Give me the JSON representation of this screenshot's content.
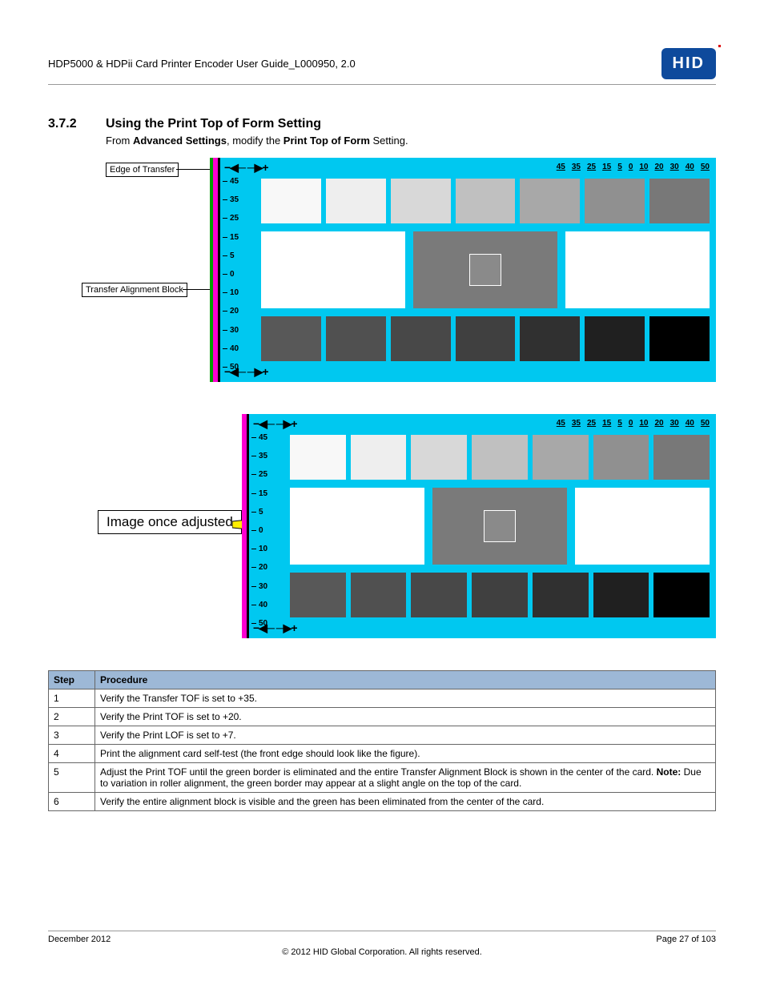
{
  "header": {
    "doc_title": "HDP5000 & HDPii Card Printer Encoder User Guide_L000950, 2.0",
    "logo_text": "HID"
  },
  "section": {
    "number": "3.7.2",
    "title": "Using the Print Top of Form Setting",
    "intro_pre": "From ",
    "intro_b1": "Advanced Settings",
    "intro_mid": ", modify the ",
    "intro_b2": "Print Top of Form",
    "intro_post": " Setting."
  },
  "figure1": {
    "callout_edge": "Edge of Transfer",
    "callout_block": "Transfer Alignment Block",
    "v_ticks": [
      "45",
      "35",
      "25",
      "15",
      "5",
      "0",
      "10",
      "20",
      "30",
      "40",
      "50"
    ],
    "h_numbers": [
      "45",
      "35",
      "25",
      "15",
      "5",
      "0",
      "10",
      "20",
      "30",
      "40",
      "50"
    ],
    "arrows": "−◀─ ─▶+"
  },
  "figure2": {
    "callout": "Image once adjusted",
    "v_ticks": [
      "45",
      "35",
      "25",
      "15",
      "5",
      "0",
      "10",
      "20",
      "30",
      "40",
      "50"
    ],
    "h_numbers": [
      "45",
      "35",
      "25",
      "15",
      "5",
      "0",
      "10",
      "20",
      "30",
      "40",
      "50"
    ],
    "arrows": "−◀─ ─▶+"
  },
  "gray_shades_top": [
    "#f8f8f8",
    "#eeeeee",
    "#d8d8d8",
    "#c0c0c0",
    "#a8a8a8",
    "#909090",
    "#787878"
  ],
  "gray_shades_bot": [
    "#585858",
    "#505050",
    "#484848",
    "#404040",
    "#303030",
    "#202020",
    "#000000"
  ],
  "table": {
    "head_step": "Step",
    "head_proc": "Procedure",
    "rows": [
      {
        "n": "1",
        "p": "Verify the Transfer TOF is set to +35."
      },
      {
        "n": "2",
        "p": "Verify the Print TOF is set to +20."
      },
      {
        "n": "3",
        "p": "Verify the Print LOF is set to +7."
      },
      {
        "n": "4",
        "p": "Print the alignment card self-test (the front edge should look like the figure)."
      },
      {
        "n": "5",
        "p_pre": "Adjust the Print TOF until the green border is eliminated and the entire Transfer Alignment Block is shown in the center of the card. ",
        "p_bold": "Note:",
        "p_post": " Due to variation in roller alignment, the green border may appear at a slight angle on the top of the card."
      },
      {
        "n": "6",
        "p": "Verify the entire alignment block is visible and the green has been eliminated from the center of the card."
      }
    ]
  },
  "footer": {
    "date": "December 2012",
    "page": "Page 27 of 103",
    "copyright": "© 2012 HID Global Corporation. All rights reserved."
  }
}
